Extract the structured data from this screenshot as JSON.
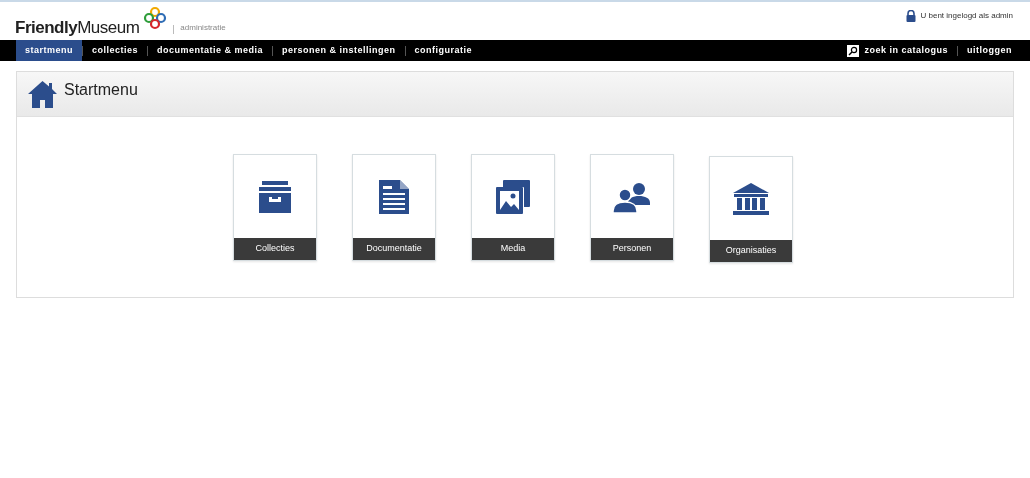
{
  "header": {
    "logo": "**Friendly**Museum",
    "subtitle": "administratie",
    "login_status": "U bent ingelogd als admin"
  },
  "nav": {
    "items": [
      {
        "label": "startmenu",
        "selected": true
      },
      {
        "label": "collecties",
        "selected": false
      },
      {
        "label": "documentatie & media",
        "selected": false
      },
      {
        "label": "personen & instellingen",
        "selected": false
      },
      {
        "label": "configuratie",
        "selected": false
      }
    ],
    "search": "zoek in catalogus",
    "logout": "uitloggen"
  },
  "panel": {
    "title": "Startmenu",
    "tiles": [
      {
        "label": "Collecties",
        "kind": "archive"
      },
      {
        "label": "Documentatie",
        "kind": "document"
      },
      {
        "label": "Media",
        "kind": "images"
      },
      {
        "label": "Personen",
        "kind": "people"
      },
      {
        "label": "Organisaties",
        "kind": "building"
      }
    ]
  }
}
